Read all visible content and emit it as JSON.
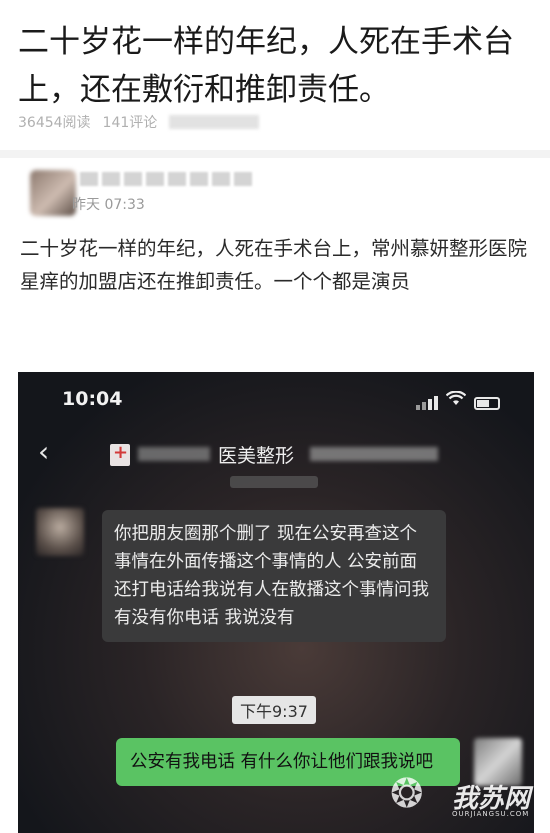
{
  "article": {
    "headline": "二十岁花一样的年纪，人死在手术台上，还在敷衍和推卸责任。",
    "reads": "36454阅读",
    "comments": "141评论"
  },
  "post": {
    "time": "昨天 07:33",
    "text": "二十岁花一样的年纪，人死在手术台上，常州慕妍整形医院星痒的加盟店还在推卸责任。一个个都是演员"
  },
  "screenshot": {
    "status_time": "10:04",
    "back_icon": "chevron-left-icon",
    "chat_title": "医美整形",
    "incoming_message": "你把朋友圈那个删了 现在公安再查这个事情在外面传播这个事情的人 公安前面还打电话给我说有人在散播这个事情问我有没有你电话 我说没有",
    "timestamp": "下午9:37",
    "outgoing_message": "公安有我电话 有什么你让他们跟我说吧",
    "bubble_colors": {
      "incoming": "#3a3a3b",
      "outgoing": "#5ac363"
    }
  },
  "watermark": {
    "text": "我苏网",
    "sub": "OURJIANGSU.COM"
  }
}
